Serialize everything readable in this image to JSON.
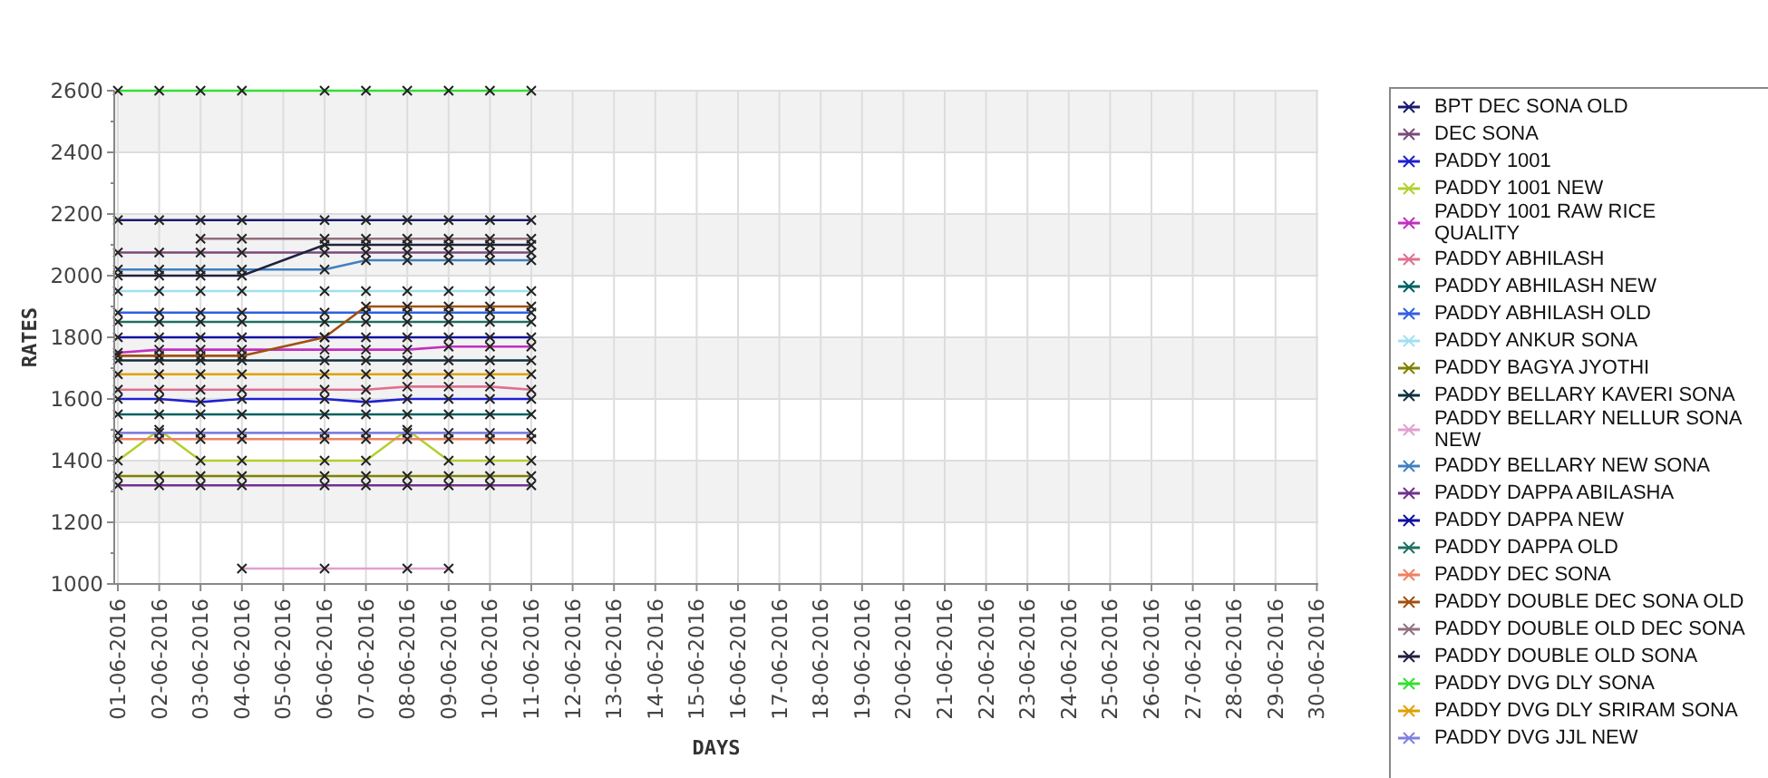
{
  "chart_data": {
    "type": "line",
    "grid": true,
    "xlabel": "DAYS",
    "ylabel": "RATES",
    "categories": [
      "01-06-2016",
      "02-06-2016",
      "03-06-2016",
      "04-06-2016",
      "05-06-2016",
      "06-06-2016",
      "07-06-2016",
      "08-06-2016",
      "09-06-2016",
      "10-06-2016",
      "11-06-2016",
      "12-06-2016",
      "13-06-2016",
      "14-06-2016",
      "15-06-2016",
      "16-06-2016",
      "17-06-2016",
      "18-06-2016",
      "19-06-2016",
      "20-06-2016",
      "21-06-2016",
      "22-06-2016",
      "23-06-2016",
      "24-06-2016",
      "25-06-2016",
      "26-06-2016",
      "27-06-2016",
      "28-06-2016",
      "29-06-2016",
      "30-06-2016"
    ],
    "ylim": [
      1000,
      2600
    ],
    "yticks": [
      1000,
      1200,
      1400,
      1600,
      1800,
      2000,
      2200,
      2400,
      2600
    ],
    "series": [
      {
        "name": "BPT DEC SONA OLD",
        "color": "#1a1a6e",
        "marker": "x",
        "values": [
          2180,
          2180,
          2180,
          2180,
          null,
          2180,
          2180,
          2180,
          2180,
          2180,
          2180,
          null,
          null,
          null,
          null,
          null,
          null,
          null,
          null,
          null,
          null,
          null,
          null,
          null,
          null,
          null,
          null,
          null,
          null,
          null
        ]
      },
      {
        "name": "DEC SONA",
        "color": "#7a4a7a",
        "marker": "x",
        "values": [
          2075,
          2075,
          2075,
          2075,
          null,
          2075,
          2075,
          2075,
          2075,
          2075,
          2075,
          null,
          null,
          null,
          null,
          null,
          null,
          null,
          null,
          null,
          null,
          null,
          null,
          null,
          null,
          null,
          null,
          null,
          null,
          null
        ]
      },
      {
        "name": "PADDY 1001",
        "color": "#2020d0",
        "marker": "x",
        "values": [
          1600,
          1600,
          1590,
          1600,
          null,
          1600,
          1590,
          1600,
          1600,
          1600,
          1600,
          null,
          null,
          null,
          null,
          null,
          null,
          null,
          null,
          null,
          null,
          null,
          null,
          null,
          null,
          null,
          null,
          null,
          null,
          null
        ]
      },
      {
        "name": "PADDY 1001 NEW",
        "color": "#b0d030",
        "marker": "x",
        "values": [
          1400,
          1500,
          1400,
          1400,
          null,
          1400,
          1400,
          1500,
          1400,
          1400,
          1400,
          null,
          null,
          null,
          null,
          null,
          null,
          null,
          null,
          null,
          null,
          null,
          null,
          null,
          null,
          null,
          null,
          null,
          null,
          null
        ]
      },
      {
        "name": "PADDY 1001 RAW RICE QUALITY",
        "color": "#c030c0",
        "marker": "x",
        "values": [
          1750,
          1760,
          1760,
          1760,
          null,
          1760,
          1760,
          1760,
          1770,
          1770,
          1770,
          null,
          null,
          null,
          null,
          null,
          null,
          null,
          null,
          null,
          null,
          null,
          null,
          null,
          null,
          null,
          null,
          null,
          null,
          null
        ]
      },
      {
        "name": "PADDY ABHILASH",
        "color": "#e07090",
        "marker": "x",
        "values": [
          1630,
          1630,
          1630,
          1630,
          null,
          1630,
          1630,
          1640,
          1640,
          1640,
          1630,
          null,
          null,
          null,
          null,
          null,
          null,
          null,
          null,
          null,
          null,
          null,
          null,
          null,
          null,
          null,
          null,
          null,
          null,
          null
        ]
      },
      {
        "name": "PADDY ABHILASH NEW",
        "color": "#006060",
        "marker": "x",
        "values": [
          1550,
          1550,
          1550,
          1550,
          null,
          1550,
          1550,
          1550,
          1550,
          1550,
          1550,
          null,
          null,
          null,
          null,
          null,
          null,
          null,
          null,
          null,
          null,
          null,
          null,
          null,
          null,
          null,
          null,
          null,
          null,
          null
        ]
      },
      {
        "name": "PADDY ABHILASH OLD",
        "color": "#3060e0",
        "marker": "x",
        "values": [
          1880,
          1880,
          1880,
          1880,
          null,
          1880,
          1880,
          1880,
          1880,
          1880,
          1880,
          null,
          null,
          null,
          null,
          null,
          null,
          null,
          null,
          null,
          null,
          null,
          null,
          null,
          null,
          null,
          null,
          null,
          null,
          null
        ]
      },
      {
        "name": "PADDY ANKUR SONA",
        "color": "#a0e0f0",
        "marker": "x",
        "values": [
          1950,
          1950,
          1950,
          1950,
          null,
          1950,
          1950,
          1950,
          1950,
          1950,
          1950,
          null,
          null,
          null,
          null,
          null,
          null,
          null,
          null,
          null,
          null,
          null,
          null,
          null,
          null,
          null,
          null,
          null,
          null,
          null
        ]
      },
      {
        "name": "PADDY BAGYA JYOTHI",
        "color": "#808000",
        "marker": "x",
        "values": [
          1350,
          1350,
          1350,
          1350,
          null,
          1350,
          1350,
          1350,
          1350,
          1350,
          1350,
          null,
          null,
          null,
          null,
          null,
          null,
          null,
          null,
          null,
          null,
          null,
          null,
          null,
          null,
          null,
          null,
          null,
          null,
          null
        ]
      },
      {
        "name": "PADDY BELLARY KAVERI SONA",
        "color": "#103040",
        "marker": "x",
        "values": [
          1725,
          1725,
          1725,
          1725,
          null,
          1725,
          1725,
          1725,
          1725,
          1725,
          1725,
          null,
          null,
          null,
          null,
          null,
          null,
          null,
          null,
          null,
          null,
          null,
          null,
          null,
          null,
          null,
          null,
          null,
          null,
          null
        ]
      },
      {
        "name": "PADDY BELLARY NELLUR SONA NEW",
        "color": "#e0a0d0",
        "marker": "x",
        "values": [
          null,
          null,
          null,
          1050,
          null,
          1050,
          null,
          1050,
          1050,
          null,
          null,
          null,
          null,
          null,
          null,
          null,
          null,
          null,
          null,
          null,
          null,
          null,
          null,
          null,
          null,
          null,
          null,
          null,
          null,
          null
        ]
      },
      {
        "name": "PADDY BELLARY NEW SONA",
        "color": "#4080c0",
        "marker": "x",
        "values": [
          2020,
          2020,
          2020,
          2020,
          null,
          2020,
          2050,
          2050,
          2050,
          2050,
          2050,
          null,
          null,
          null,
          null,
          null,
          null,
          null,
          null,
          null,
          null,
          null,
          null,
          null,
          null,
          null,
          null,
          null,
          null,
          null
        ]
      },
      {
        "name": "PADDY DAPPA ABILASHA",
        "color": "#703090",
        "marker": "x",
        "values": [
          1320,
          1320,
          1320,
          1320,
          null,
          1320,
          1320,
          1320,
          1320,
          1320,
          1320,
          null,
          null,
          null,
          null,
          null,
          null,
          null,
          null,
          null,
          null,
          null,
          null,
          null,
          null,
          null,
          null,
          null,
          null,
          null
        ]
      },
      {
        "name": "PADDY DAPPA NEW",
        "color": "#1010a0",
        "marker": "x",
        "values": [
          1800,
          1800,
          1800,
          1800,
          null,
          1800,
          1800,
          1800,
          1800,
          1800,
          1800,
          null,
          null,
          null,
          null,
          null,
          null,
          null,
          null,
          null,
          null,
          null,
          null,
          null,
          null,
          null,
          null,
          null,
          null,
          null
        ]
      },
      {
        "name": "PADDY DAPPA OLD",
        "color": "#207060",
        "marker": "x",
        "values": [
          1850,
          1850,
          1850,
          1850,
          null,
          1850,
          1850,
          1850,
          1850,
          1850,
          1850,
          null,
          null,
          null,
          null,
          null,
          null,
          null,
          null,
          null,
          null,
          null,
          null,
          null,
          null,
          null,
          null,
          null,
          null,
          null
        ]
      },
      {
        "name": "PADDY DEC SONA",
        "color": "#f08060",
        "marker": "x",
        "values": [
          1470,
          1470,
          1470,
          1470,
          null,
          1470,
          1470,
          1470,
          1470,
          1470,
          1470,
          null,
          null,
          null,
          null,
          null,
          null,
          null,
          null,
          null,
          null,
          null,
          null,
          null,
          null,
          null,
          null,
          null,
          null,
          null
        ]
      },
      {
        "name": "PADDY DOUBLE DEC SONA OLD",
        "color": "#a05010",
        "marker": "x",
        "values": [
          1740,
          1740,
          1740,
          1740,
          null,
          1800,
          1900,
          1900,
          1900,
          1900,
          1900,
          null,
          null,
          null,
          null,
          null,
          null,
          null,
          null,
          null,
          null,
          null,
          null,
          null,
          null,
          null,
          null,
          null,
          null,
          null
        ]
      },
      {
        "name": "PADDY DOUBLE OLD DEC SONA",
        "color": "#907080",
        "marker": "x",
        "values": [
          null,
          null,
          2120,
          2120,
          null,
          2120,
          2120,
          2120,
          2120,
          2120,
          2120,
          null,
          null,
          null,
          null,
          null,
          null,
          null,
          null,
          null,
          null,
          null,
          null,
          null,
          null,
          null,
          null,
          null,
          null,
          null
        ]
      },
      {
        "name": "PADDY DOUBLE OLD SONA",
        "color": "#202040",
        "marker": "x",
        "values": [
          2000,
          2000,
          2000,
          2000,
          null,
          2100,
          2100,
          2100,
          2100,
          2100,
          2100,
          null,
          null,
          null,
          null,
          null,
          null,
          null,
          null,
          null,
          null,
          null,
          null,
          null,
          null,
          null,
          null,
          null,
          null,
          null
        ]
      },
      {
        "name": "PADDY DVG DLY SONA",
        "color": "#30e030",
        "marker": "x",
        "values": [
          2600,
          2600,
          2600,
          2600,
          null,
          2600,
          2600,
          2600,
          2600,
          2600,
          2600,
          null,
          null,
          null,
          null,
          null,
          null,
          null,
          null,
          null,
          null,
          null,
          null,
          null,
          null,
          null,
          null,
          null,
          null,
          null
        ]
      },
      {
        "name": "PADDY DVG DLY SRIRAM SONA",
        "color": "#e0a000",
        "marker": "x",
        "values": [
          1680,
          1680,
          1680,
          1680,
          null,
          1680,
          1680,
          1680,
          1680,
          1680,
          1680,
          null,
          null,
          null,
          null,
          null,
          null,
          null,
          null,
          null,
          null,
          null,
          null,
          null,
          null,
          null,
          null,
          null,
          null,
          null
        ]
      },
      {
        "name": "PADDY DVG JJL NEW",
        "color": "#8080e0",
        "marker": "x",
        "values": [
          1490,
          1490,
          1490,
          1490,
          null,
          1490,
          1490,
          1490,
          1490,
          1490,
          1490,
          null,
          null,
          null,
          null,
          null,
          null,
          null,
          null,
          null,
          null,
          null,
          null,
          null,
          null,
          null,
          null,
          null,
          null,
          null
        ]
      }
    ]
  }
}
